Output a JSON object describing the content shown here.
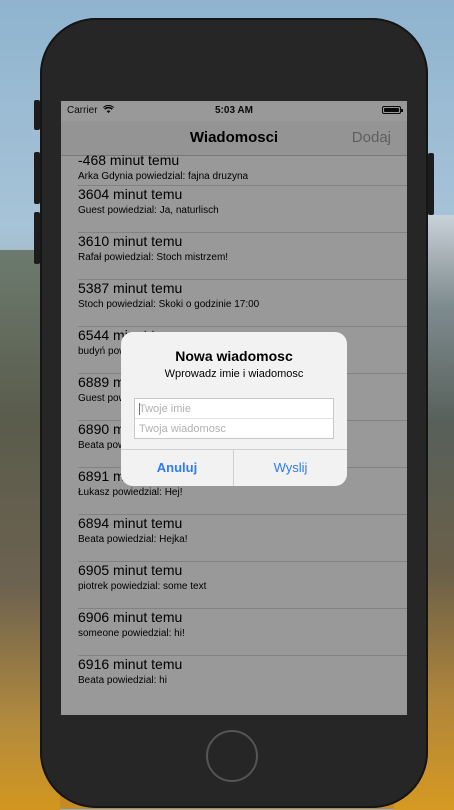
{
  "status_bar": {
    "carrier": "Carrier",
    "time": "5:03 AM"
  },
  "navbar": {
    "title": "Wiadomosci",
    "add_label": "Dodaj"
  },
  "messages": [
    {
      "time": "-468 minut temu",
      "text": "Arka Gdynia powiedzial: fajna druzyna"
    },
    {
      "time": "3604 minut temu",
      "text": "Guest powiedzial: Ja, naturlisch"
    },
    {
      "time": "3610 minut temu",
      "text": "Rafał powiedzial: Stoch mistrzem!"
    },
    {
      "time": "5387 minut temu",
      "text": "Stoch powiedzial: Skoki o godzinie 17:00"
    },
    {
      "time": "6544 minut temu",
      "text": "budyń powiedzial: "
    },
    {
      "time": "6889 minut temu",
      "text": "Guest powiedzial: "
    },
    {
      "time": "6890 minut temu",
      "text": "Beata powiedzial: "
    },
    {
      "time": "6891 minut temu",
      "text": "Łukasz powiedzial: Hej!"
    },
    {
      "time": "6894 minut temu",
      "text": "Beata powiedzial: Hejka!"
    },
    {
      "time": "6905 minut temu",
      "text": "piotrek powiedzial: some text"
    },
    {
      "time": "6906 minut temu",
      "text": "someone powiedzial: hi!"
    },
    {
      "time": "6916 minut temu",
      "text": "Beata powiedzial: hi"
    }
  ],
  "alert": {
    "title": "Nowa wiadomosc",
    "message": "Wprowadz imie i wiadomosc",
    "name_placeholder": "Twoje imie",
    "message_placeholder": "Twoja wiadomosc",
    "cancel_label": "Anuluj",
    "send_label": "Wyslij"
  },
  "colors": {
    "accent": "#2f7bf5",
    "nav_button_disabled": "#9e9e9e"
  }
}
